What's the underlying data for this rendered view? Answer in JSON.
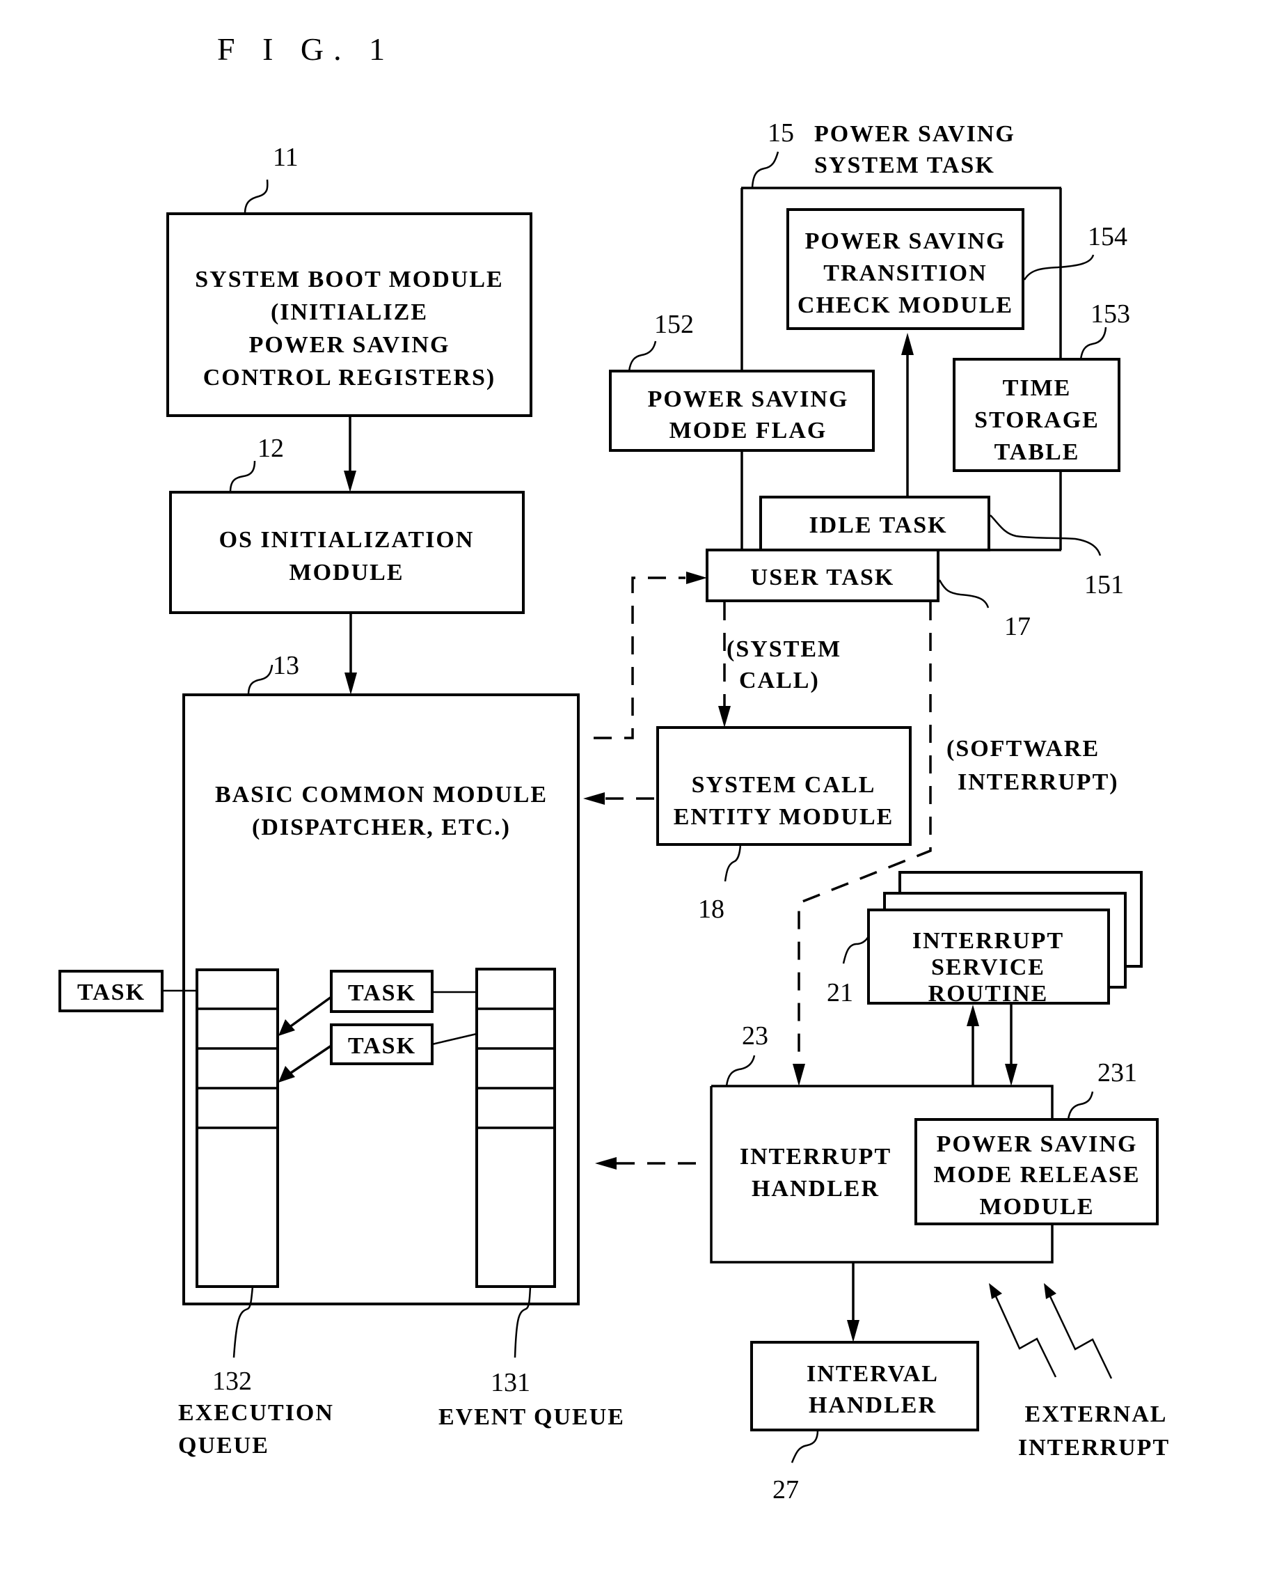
{
  "figure": {
    "title": "F I G. 1",
    "blocks": {
      "system_boot": {
        "ref": "11",
        "lines": [
          "SYSTEM BOOT MODULE",
          "(INITIALIZE",
          "POWER SAVING",
          "CONTROL REGISTERS)"
        ]
      },
      "os_init": {
        "ref": "12",
        "lines": [
          "OS INITIALIZATION",
          "MODULE"
        ]
      },
      "basic_common": {
        "ref": "13",
        "lines": [
          "BASIC COMMON MODULE",
          "(DISPATCHER, ETC.)"
        ]
      },
      "power_saving_system_task": {
        "ref": "15",
        "lines": [
          "POWER SAVING",
          "SYSTEM TASK"
        ]
      },
      "idle_task": {
        "ref": "151",
        "lines": [
          "IDLE TASK"
        ]
      },
      "mode_flag": {
        "ref": "152",
        "lines": [
          "POWER SAVING",
          "MODE FLAG"
        ]
      },
      "time_storage": {
        "ref": "153",
        "lines": [
          "TIME",
          "STORAGE",
          "TABLE"
        ]
      },
      "transition_check": {
        "ref": "154",
        "lines": [
          "POWER SAVING",
          "TRANSITION",
          "CHECK MODULE"
        ]
      },
      "user_task": {
        "ref": "17",
        "lines": [
          "USER TASK"
        ]
      },
      "system_call_entity": {
        "ref": "18",
        "lines": [
          "SYSTEM CALL",
          "ENTITY MODULE"
        ]
      },
      "isr": {
        "ref": "21",
        "lines": [
          "INTERRUPT",
          "SERVICE",
          "ROUTINE"
        ]
      },
      "interrupt_handler": {
        "ref": "23",
        "lines": [
          "INTERRUPT",
          "HANDLER"
        ]
      },
      "mode_release": {
        "ref": "231",
        "lines": [
          "POWER SAVING",
          "MODE RELEASE",
          "MODULE"
        ]
      },
      "interval_handler": {
        "ref": "27",
        "lines": [
          "INTERVAL",
          "HANDLER"
        ]
      }
    },
    "queues": {
      "execution": {
        "ref": "132",
        "lines": [
          "EXECUTION",
          "QUEUE"
        ]
      },
      "event": {
        "ref": "131",
        "lines": [
          "EVENT QUEUE"
        ]
      }
    },
    "task_label": "TASK",
    "annotations": {
      "system_call": [
        "(SYSTEM",
        "CALL)"
      ],
      "software_interrupt": [
        "(SOFTWARE",
        "INTERRUPT)"
      ],
      "external_interrupt": [
        "EXTERNAL",
        "INTERRUPT"
      ]
    }
  }
}
